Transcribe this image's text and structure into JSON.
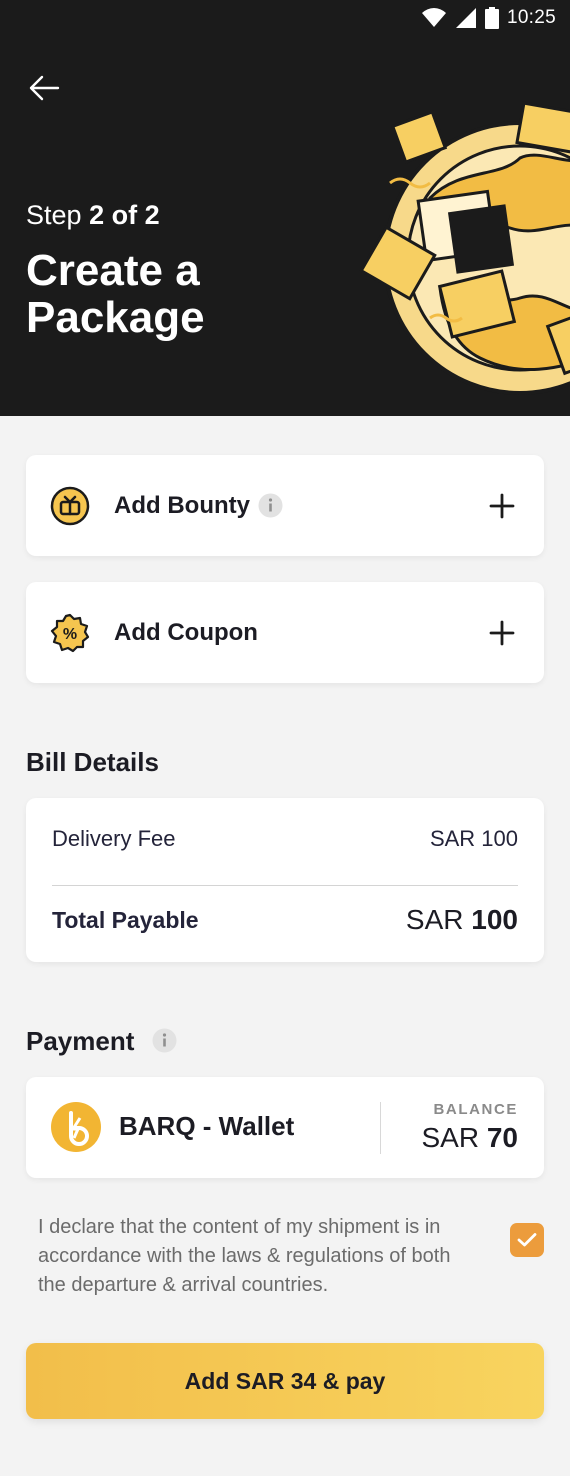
{
  "status_bar": {
    "time": "10:25"
  },
  "header": {
    "step_prefix": "Step",
    "step_value": "2 of 2",
    "title": "Create a Package"
  },
  "options": {
    "bounty_label": "Add Bounty",
    "coupon_label": "Add Coupon"
  },
  "bill": {
    "section_title": "Bill Details",
    "delivery_fee_label": "Delivery Fee",
    "delivery_fee_value": "SAR 100",
    "total_label": "Total Payable",
    "total_currency": "SAR",
    "total_amount": "100"
  },
  "payment": {
    "section_title": "Payment",
    "wallet_name": "BARQ - Wallet",
    "balance_label": "BALANCE",
    "balance_currency": "SAR",
    "balance_amount": "70"
  },
  "declaration": {
    "text": "I declare that the content of my shipment is in accordance with the laws & regulations of both the departure & arrival countries.",
    "checked": true
  },
  "cta": {
    "label": "Add SAR 34 & pay"
  },
  "colors": {
    "accent": "#f5c54f",
    "checkbox": "#ec9c3c",
    "header_bg": "#1b1b1b"
  }
}
